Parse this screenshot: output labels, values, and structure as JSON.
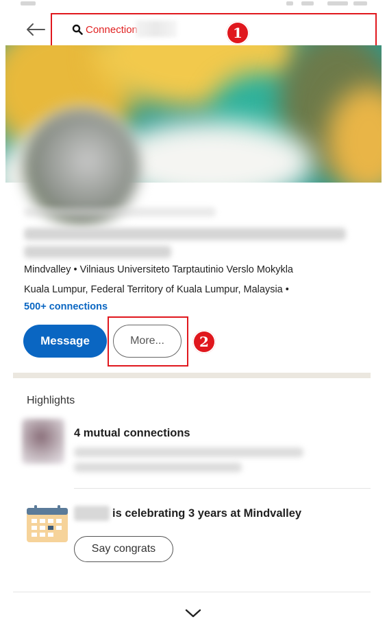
{
  "header": {
    "search_label": "Connection Name"
  },
  "annotations": [
    {
      "number": "1"
    },
    {
      "number": "2"
    }
  ],
  "profile": {
    "education_line": "Mindvalley • Vilniaus Universiteto Tarptautinio Verslo Mokykla",
    "location_line": "Kuala Lumpur, Federal Territory of Kuala Lumpur, Malaysia •",
    "connections": "500+ connections"
  },
  "actions": {
    "message_label": "Message",
    "more_label": "More..."
  },
  "highlights": {
    "title": "Highlights",
    "mutual_title": "4 mutual connections",
    "celebrate_text": "is celebrating 3 years at Mindvalley",
    "congrats_label": "Say congrats"
  },
  "colors": {
    "accent_blue": "#0a66c2",
    "annotation_red": "#e0171d",
    "search_text_red": "#e02020"
  }
}
